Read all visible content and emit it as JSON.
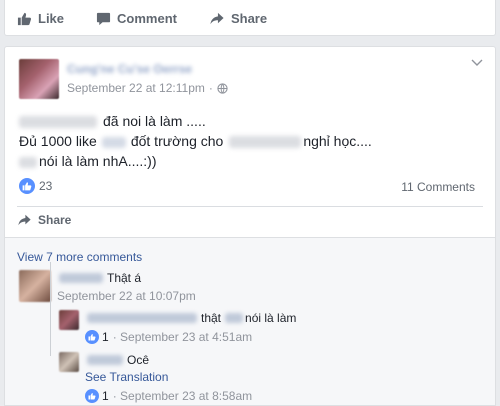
{
  "prev_actions": {
    "like": "Like",
    "comment": "Comment",
    "share": "Share"
  },
  "post": {
    "author": "Cung'ne Cu'se Oerrse",
    "timestamp": "September 22 at 12:11pm",
    "visibility_icon": "globe-icon",
    "lines": [
      {
        "prefix": "",
        "text": "đã noi là làm ....."
      },
      {
        "prefix": "Đủ 1000 like",
        "middle": "đốt trường",
        "suffix_a": "cho",
        "suffix_b": "nghỉ học...."
      },
      {
        "prefix": "",
        "text": "nói là làm nhA....:))"
      }
    ],
    "reactions_count": "23",
    "comments_count": "11 Comments",
    "share_label": "Share"
  },
  "comments": {
    "view_more": "View 7 more comments",
    "items": [
      {
        "text": "Thật á",
        "time": "September 22 at 10:07pm"
      },
      {
        "text_a": "thật",
        "text_b": "nói là làm",
        "likes": "1",
        "time": "September 23 at 4:51am"
      },
      {
        "text": "Ocê",
        "translation": "See Translation",
        "likes": "1",
        "time": "September 23 at 8:58am"
      }
    ]
  },
  "colors": {
    "link": "#365899",
    "like_blue": "#5890ff",
    "meta_gray": "#90949c"
  }
}
